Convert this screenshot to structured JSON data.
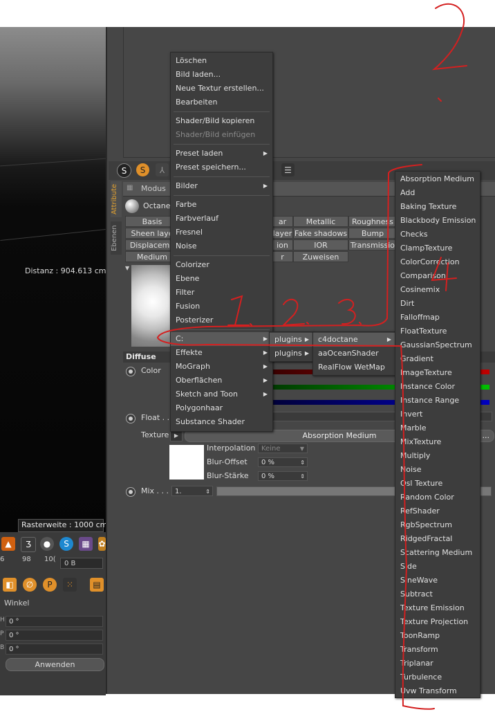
{
  "viewport": {
    "distance": "Distanz : 904.613 cm",
    "grid": "Rasterweite : 1000 cm"
  },
  "timeline": {
    "frames": [
      "6",
      "98",
      "10("
    ],
    "frame_value": "0 B"
  },
  "coords": {
    "header": "Winkel",
    "rows": [
      {
        "axis": "H",
        "value": "0 °"
      },
      {
        "axis": "P",
        "value": "0 °"
      },
      {
        "axis": "B",
        "value": "0 °"
      }
    ],
    "apply": "Anwenden"
  },
  "attributes": {
    "side_tabs": [
      "Attribute",
      "Ebenen"
    ],
    "mode": "Modus",
    "material_name": "Octanel",
    "tabs_row1": [
      "Basis",
      "ar",
      "Metallic",
      "Roughness"
    ],
    "tabs_row2": [
      "Sheen laye",
      "layer",
      "Fake shadows",
      "Bump"
    ],
    "tabs_row3": [
      "Displaceme",
      "ion",
      "IOR",
      "Transmissio"
    ],
    "tabs_row4": [
      "Medium",
      "r",
      "Zuweisen"
    ],
    "section": "Diffuse",
    "color_label": "Color",
    "float_label": "Float . .",
    "texture_label": "Texture",
    "texture_value": "Absorption Medium",
    "texture_more": "...",
    "interpolation_label": "Interpolation",
    "interpolation_value": "Keine",
    "blur_offset_label": "Blur-Offset",
    "blur_offset_value": "0 %",
    "blur_strength_label": "Blur-Stärke",
    "blur_strength_value": "0 %",
    "mix_label": "Mix . . .",
    "mix_value": "1."
  },
  "context_menu": {
    "items": [
      {
        "label": "Löschen"
      },
      {
        "label": "Bild laden..."
      },
      {
        "label": "Neue Textur erstellen..."
      },
      {
        "label": "Bearbeiten"
      },
      {
        "label": "Shader/Bild kopieren"
      },
      {
        "label": "Shader/Bild einfügen"
      },
      {
        "label": "Preset laden"
      },
      {
        "label": "Preset speichern..."
      },
      {
        "label": "Bilder"
      },
      {
        "label": "Farbe"
      },
      {
        "label": "Farbverlauf"
      },
      {
        "label": "Fresnel"
      },
      {
        "label": "Noise"
      },
      {
        "label": "Colorizer"
      },
      {
        "label": "Ebene"
      },
      {
        "label": "Filter"
      },
      {
        "label": "Fusion"
      },
      {
        "label": "Posterizer"
      },
      {
        "label": "C:"
      },
      {
        "label": "Effekte"
      },
      {
        "label": "MoGraph"
      },
      {
        "label": "Oberflächen"
      },
      {
        "label": "Sketch and Toon"
      },
      {
        "label": "Polygonhaar"
      },
      {
        "label": "Substance Shader"
      }
    ]
  },
  "plugins_menu": {
    "items": [
      {
        "label": "plugins"
      },
      {
        "label": "plugins"
      }
    ]
  },
  "c4doctane_menu": {
    "items": [
      {
        "label": "c4doctane"
      },
      {
        "label": "aaOceanShader"
      },
      {
        "label": "RealFlow WetMap"
      }
    ]
  },
  "octane_menu": {
    "items": [
      {
        "label": "Absorption Medium"
      },
      {
        "label": "Add"
      },
      {
        "label": "Baking Texture"
      },
      {
        "label": "Blackbody Emission"
      },
      {
        "label": "Checks"
      },
      {
        "label": "ClampTexture"
      },
      {
        "label": "ColorCorrection"
      },
      {
        "label": "Comparison"
      },
      {
        "label": "Cosinemix"
      },
      {
        "label": "Dirt"
      },
      {
        "label": "Falloffmap"
      },
      {
        "label": "FloatTexture"
      },
      {
        "label": "GaussianSpectrum"
      },
      {
        "label": "Gradient"
      },
      {
        "label": "ImageTexture"
      },
      {
        "label": "Instance Color"
      },
      {
        "label": "Instance Range"
      },
      {
        "label": "Invert"
      },
      {
        "label": "Marble"
      },
      {
        "label": "MixTexture"
      },
      {
        "label": "Multiply"
      },
      {
        "label": "Noise"
      },
      {
        "label": "Osl Texture"
      },
      {
        "label": "Random Color"
      },
      {
        "label": "RefShader"
      },
      {
        "label": "RgbSpectrum"
      },
      {
        "label": "RidgedFractal"
      },
      {
        "label": "Scattering Medium"
      },
      {
        "label": "Side"
      },
      {
        "label": "SineWave"
      },
      {
        "label": "Subtract"
      },
      {
        "label": "Texture Emission"
      },
      {
        "label": "Texture Projection"
      },
      {
        "label": "ToonRamp"
      },
      {
        "label": "Transform"
      },
      {
        "label": "Triplanar"
      },
      {
        "label": "Turbulence"
      },
      {
        "label": "Uvw Transform"
      }
    ]
  },
  "annotations": [
    "1.",
    "2.",
    "3.",
    "4",
    "2"
  ],
  "colors": {
    "annotation": "#d42020",
    "menu_bg": "#3d3d3d",
    "highlight": "#5a5a5a",
    "panel": "#464646"
  }
}
